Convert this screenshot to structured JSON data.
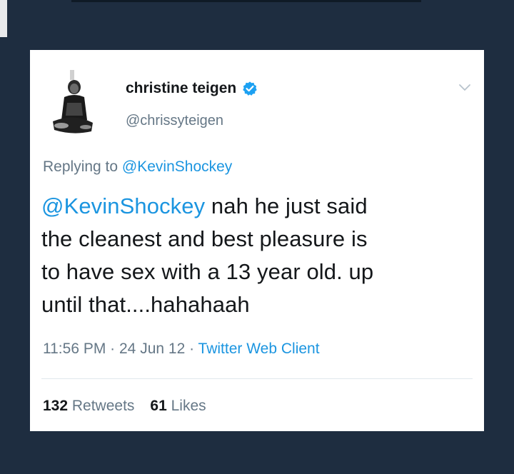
{
  "tweet": {
    "display_name": "christine teigen",
    "handle": "@chrissyteigen",
    "reply_prefix": "Replying to ",
    "reply_to": "@KevinShockey",
    "mention": "@KevinShockey",
    "text_line1_rest": " nah he just said",
    "text_line2": "the cleanest and best pleasure is",
    "text_line3": "to have sex with a 13 year old. up",
    "text_line4": "until that....hahahaah",
    "time": "11:56 PM",
    "sep1": " · ",
    "date": "24 Jun 12",
    "sep2": " · ",
    "client": "Twitter Web Client",
    "retweets_count": "132",
    "retweets_label": " Retweets",
    "likes_count": "61",
    "likes_label": " Likes"
  },
  "icons": {
    "verified": "verified-badge-icon",
    "chevron": "chevron-down-icon",
    "avatar": "avatar"
  },
  "colors": {
    "background": "#1e2d40",
    "card": "#ffffff",
    "link": "#1b95e0",
    "text": "#14171a",
    "muted": "#657786"
  }
}
